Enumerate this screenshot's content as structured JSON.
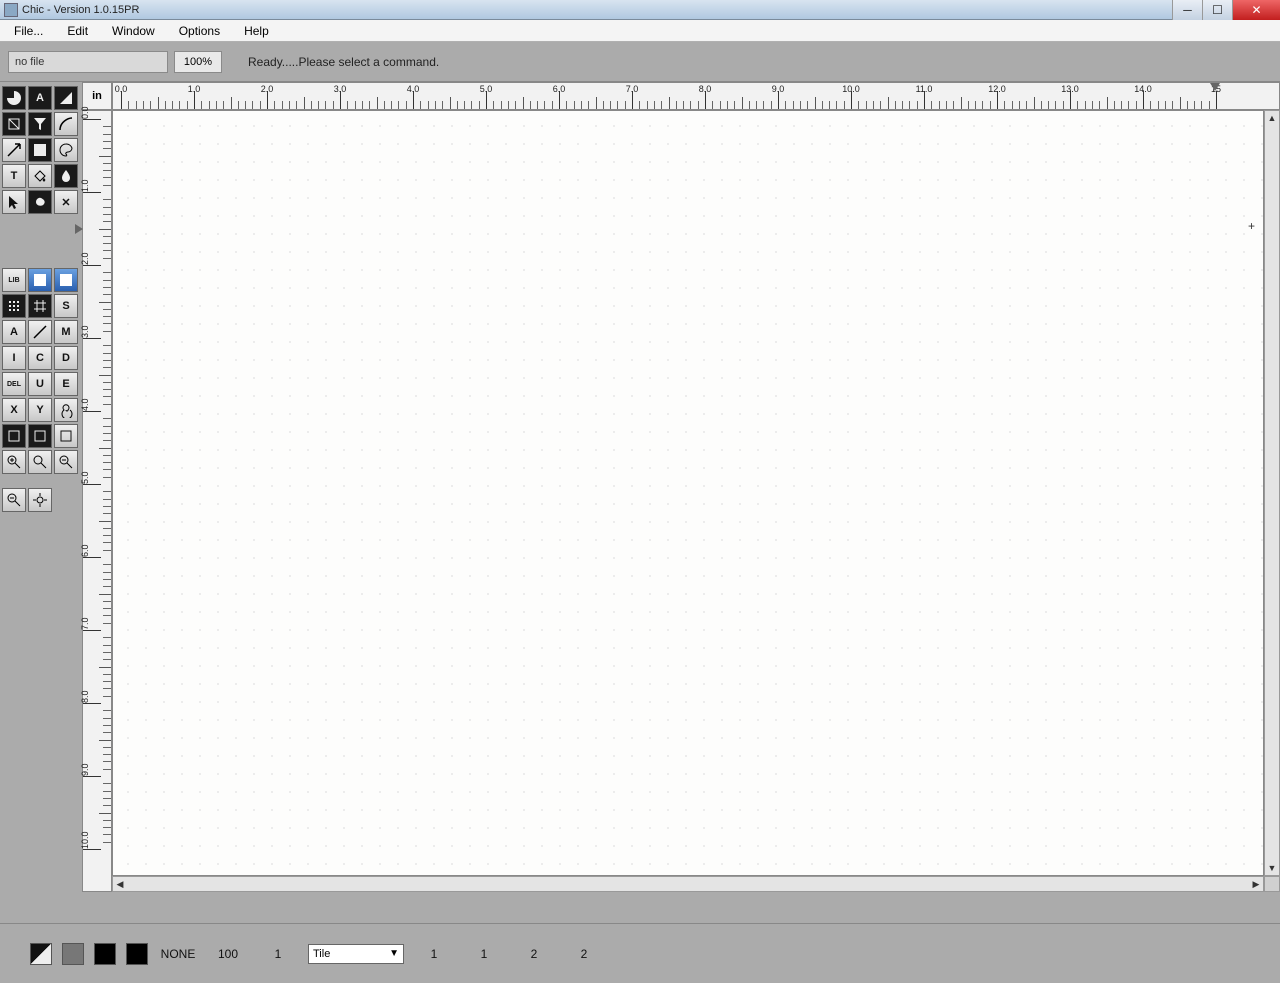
{
  "window": {
    "title": "Chic - Version 1.0.15PR"
  },
  "menu": {
    "items": [
      "File...",
      "Edit",
      "Window",
      "Options",
      "Help"
    ]
  },
  "infobar": {
    "filename": "no file",
    "zoom": "100%",
    "status": "Ready.....Please select a command."
  },
  "canvas": {
    "unit": "in",
    "h_labels": [
      "0.0",
      "1.0",
      "2.0",
      "3.0",
      "4.0",
      "5.0",
      "6.0",
      "7.0",
      "8.0",
      "9.0",
      "10.0",
      "11.0",
      "12.0",
      "13.0",
      "14.0",
      "15"
    ],
    "v_labels": [
      "0.0",
      "1.0",
      "2.0",
      "3.0",
      "4.0",
      "5.0",
      "6.0",
      "7.0",
      "8.0",
      "9.0",
      "10.0"
    ]
  },
  "tools": {
    "group1": [
      {
        "name": "pie-tool-icon",
        "type": "dark"
      },
      {
        "name": "text-a-tool-icon",
        "type": "dark",
        "label": "A"
      },
      {
        "name": "right-triangle-tool-icon",
        "type": "dark"
      },
      {
        "name": "shape-tool-icon",
        "type": "dark"
      },
      {
        "name": "funnel-tool-icon",
        "type": "dark"
      },
      {
        "name": "curve-tool-icon",
        "type": "light"
      },
      {
        "name": "arrow-tool-icon",
        "type": "light"
      },
      {
        "name": "fill-square-tool-icon",
        "type": "dark"
      },
      {
        "name": "palette-tool-icon",
        "type": "light"
      },
      {
        "name": "text-tool-icon",
        "type": "light",
        "label": "T"
      },
      {
        "name": "bucket-tool-icon",
        "type": "light"
      },
      {
        "name": "drop-tool-icon",
        "type": "dark"
      },
      {
        "name": "pointer-tool-icon",
        "type": "light"
      },
      {
        "name": "blob-tool-icon",
        "type": "dark"
      },
      {
        "name": "scissors-tool-icon",
        "type": "light",
        "label": "✕"
      }
    ],
    "group2": [
      {
        "name": "lib-button",
        "label": "LIB",
        "type": "light"
      },
      {
        "name": "gradient-button",
        "type": "blue"
      },
      {
        "name": "solid-blue-button",
        "type": "blue"
      },
      {
        "name": "grid-dot-button",
        "type": "dark"
      },
      {
        "name": "grid-hash-button",
        "type": "dark"
      },
      {
        "name": "s-button",
        "label": "S",
        "type": "light"
      },
      {
        "name": "a-button",
        "label": "A",
        "type": "light"
      },
      {
        "name": "diag-button",
        "type": "light"
      },
      {
        "name": "m-button",
        "label": "M",
        "type": "light"
      },
      {
        "name": "i-button",
        "label": "I",
        "type": "light"
      },
      {
        "name": "c-button",
        "label": "C",
        "type": "light"
      },
      {
        "name": "d-button",
        "label": "D",
        "type": "light"
      },
      {
        "name": "del-button",
        "label": "DEL",
        "type": "light"
      },
      {
        "name": "u-button",
        "label": "U",
        "type": "light"
      },
      {
        "name": "e-button",
        "label": "E",
        "type": "light"
      },
      {
        "name": "x-button",
        "label": "X",
        "type": "light"
      },
      {
        "name": "y-button",
        "label": "Y",
        "type": "light"
      },
      {
        "name": "spiral-button",
        "type": "light"
      },
      {
        "name": "icon1-button",
        "type": "dark"
      },
      {
        "name": "icon2-button",
        "type": "dark"
      },
      {
        "name": "icon3-button",
        "type": "light"
      },
      {
        "name": "zoom-in-button",
        "type": "light"
      },
      {
        "name": "zoom-reset-button",
        "type": "light"
      },
      {
        "name": "zoom-out-button",
        "type": "light"
      }
    ],
    "group3": [
      {
        "name": "zoom-minus-button",
        "type": "light"
      },
      {
        "name": "target-button",
        "type": "light"
      }
    ]
  },
  "bottombar": {
    "none_label": "NONE",
    "val1": "100",
    "val2": "1",
    "tile_label": "Tile",
    "val3": "1",
    "val4": "1",
    "val5": "2",
    "val6": "2"
  }
}
